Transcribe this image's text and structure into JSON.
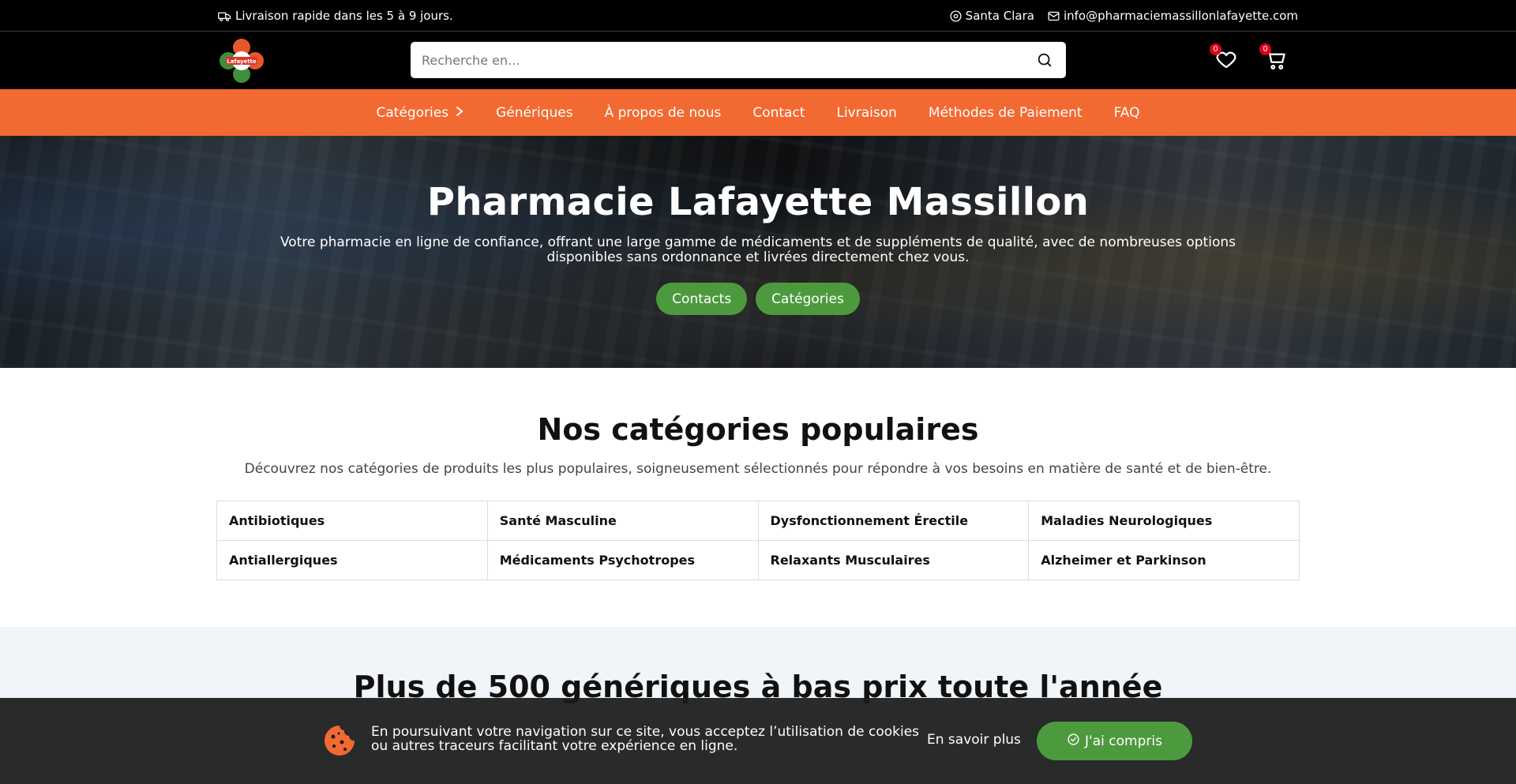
{
  "topbar": {
    "delivery_text": "Livraison rapide dans les 5 à 9 jours.",
    "location": "Santa Clara",
    "email": "info@pharmaciemassillonlafayette.com"
  },
  "header": {
    "logo_text": "Lafayette",
    "search_placeholder": "Recherche en...",
    "wishlist_count": "0",
    "cart_count": "0"
  },
  "nav": {
    "items": [
      "Catégories",
      "Génériques",
      "À propos de nous",
      "Contact",
      "Livraison",
      "Méthodes de Paiement",
      "FAQ"
    ]
  },
  "hero": {
    "title": "Pharmacie Lafayette Massillon",
    "subtitle": "Votre pharmacie en ligne de confiance, offrant une large gamme de médicaments et de suppléments de qualité, avec de nombreuses options disponibles sans ordonnance et livrées directement chez vous.",
    "btn_contacts": "Contacts",
    "btn_categories": "Catégories"
  },
  "categories": {
    "title": "Nos catégories populaires",
    "subtitle": "Découvrez nos catégories de produits les plus populaires, soigneusement sélectionnés pour répondre à vos besoins en matière de santé et de bien-être.",
    "items": [
      "Antibiotiques",
      "Santé Masculine",
      "Dysfonctionnement Érectile",
      "Maladies Neurologiques",
      "Antiallergiques",
      "Médicaments Psychotropes",
      "Relaxants Musculaires",
      "Alzheimer et Parkinson"
    ]
  },
  "generics": {
    "title": "Plus de 500 génériques à bas prix toute l'année"
  },
  "cookie": {
    "text": "En poursuivant votre navigation sur ce site, vous acceptez l’utilisation de cookies ou autres traceurs facilitant votre expérience en ligne.",
    "more": "En savoir plus",
    "accept": "J'ai compris"
  },
  "colors": {
    "nav_bg": "#f26a32",
    "button_green": "#4d9a3e",
    "badge_red": "#e0001b",
    "cookie_icon": "#f26a32"
  },
  "icons": [
    "truck-icon",
    "location-icon",
    "mail-icon",
    "search-icon",
    "heart-icon",
    "cart-icon",
    "chevron-right-icon",
    "cookie-icon",
    "check-circle-icon"
  ]
}
